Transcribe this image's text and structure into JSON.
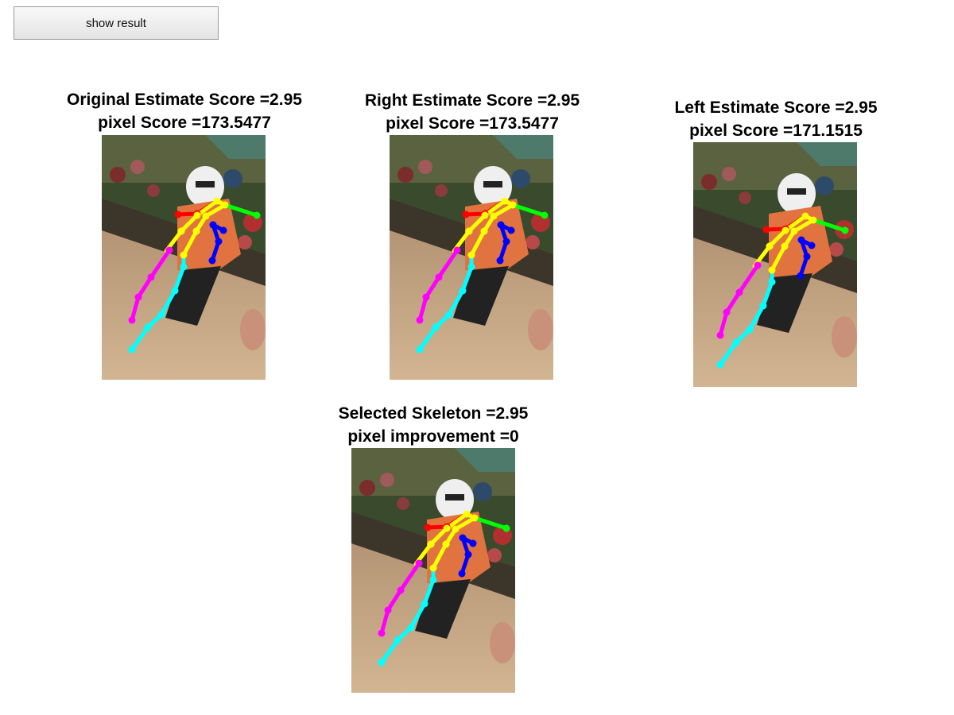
{
  "toolbar": {
    "show_result_label": "show result"
  },
  "panels": {
    "original": {
      "line1": "Original Estimate Score =2.95",
      "line2": "pixel Score =173.5477"
    },
    "right": {
      "line1": "Right Estimate Score =2.95",
      "line2": "pixel Score =173.5477"
    },
    "left": {
      "line1": "Left Estimate Score =2.95",
      "line2": "pixel Score =171.1515"
    },
    "selected": {
      "line1": "Selected Skeleton =2.95",
      "line2": "pixel improvement =0"
    }
  },
  "limb_colors": {
    "torso": "#ff0000",
    "body": "#ffff00",
    "head": "#00ff00",
    "left_arm": "#0000ff",
    "left_leg": "#ff00ff",
    "right_leg": "#00ffff"
  }
}
